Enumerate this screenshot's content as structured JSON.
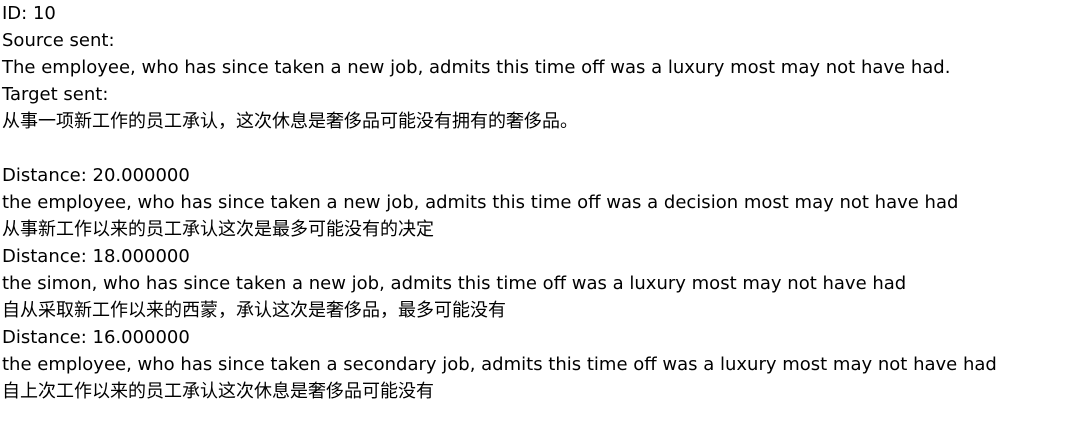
{
  "header": {
    "id_line": "ID: 10",
    "source_label": "Source sent:",
    "source_text": "The employee, who has since taken a new job, admits this time off was a luxury most may not have had.",
    "target_label": "Target sent:",
    "target_text": "从事一项新工作的员工承认，这次休息是奢侈品可能没有拥有的奢侈品。"
  },
  "results": [
    {
      "distance": "Distance: 20.000000",
      "english": "the employee, who has since taken a new job, admits this time off was a decision most may not have had",
      "chinese": "从事新工作以来的员工承认这次是最多可能没有的决定"
    },
    {
      "distance": "Distance: 18.000000",
      "english": "the simon, who has since taken a new job, admits this time off was a luxury most may not have had",
      "chinese": "自从采取新工作以来的西蒙，承认这次是奢侈品，最多可能没有"
    },
    {
      "distance": "Distance: 16.000000",
      "english": "the employee, who has since taken a secondary job, admits this time off was a luxury most may not have had",
      "chinese": "自上次工作以来的员工承认这次休息是奢侈品可能没有"
    }
  ]
}
